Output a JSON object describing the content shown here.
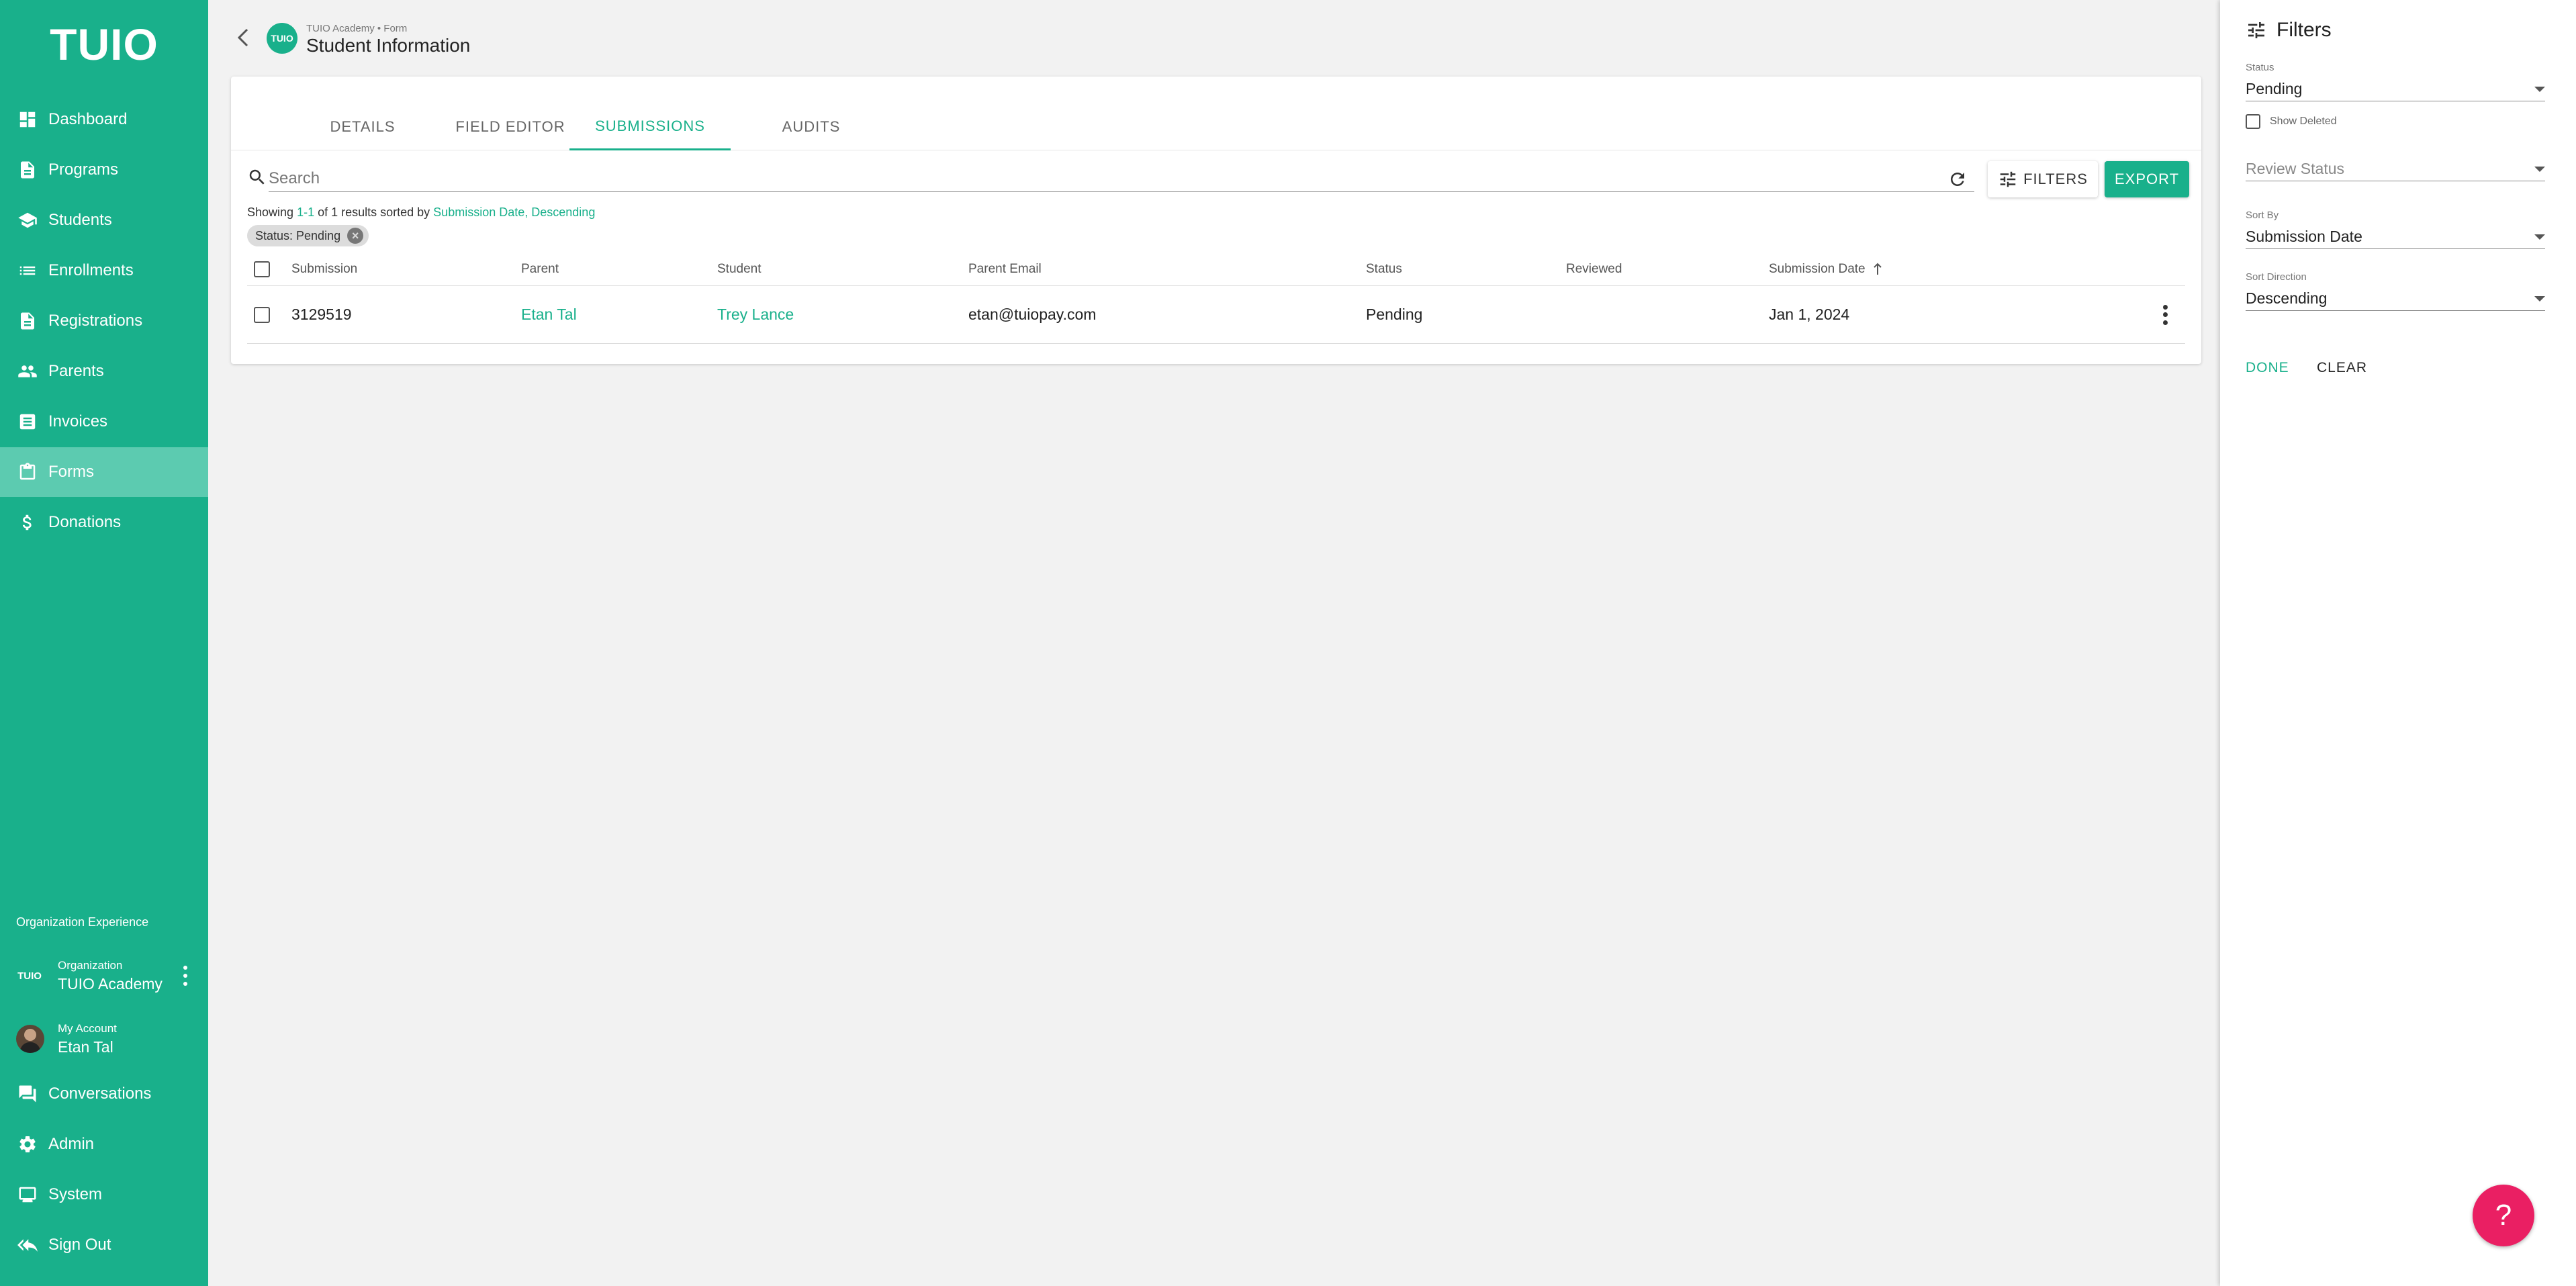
{
  "sidebar": {
    "logo": "TUIO",
    "items": [
      {
        "label": "Dashboard",
        "icon": "dashboard-icon"
      },
      {
        "label": "Programs",
        "icon": "document-icon"
      },
      {
        "label": "Students",
        "icon": "school-icon"
      },
      {
        "label": "Enrollments",
        "icon": "list-icon"
      },
      {
        "label": "Registrations",
        "icon": "document-icon"
      },
      {
        "label": "Parents",
        "icon": "people-icon"
      },
      {
        "label": "Invoices",
        "icon": "receipt-icon"
      },
      {
        "label": "Forms",
        "icon": "clipboard-icon"
      },
      {
        "label": "Donations",
        "icon": "dollar-icon"
      }
    ],
    "active_item": "Forms",
    "org_experience": "Organization Experience",
    "org": {
      "badge": "TUIO",
      "caption": "Organization",
      "name": "TUIO Academy"
    },
    "account": {
      "caption": "My Account",
      "name": "Etan Tal"
    },
    "bottom_items": [
      {
        "label": "Conversations",
        "icon": "chat-icon"
      },
      {
        "label": "Admin",
        "icon": "gear-icon"
      },
      {
        "label": "System",
        "icon": "monitor-icon"
      },
      {
        "label": "Sign Out",
        "icon": "sign-out-icon"
      }
    ]
  },
  "header": {
    "badge": "TUIO",
    "breadcrumb": "TUIO Academy • Form",
    "title": "Student Information"
  },
  "tabs": [
    {
      "label": "DETAILS"
    },
    {
      "label": "FIELD EDITOR"
    },
    {
      "label": "SUBMISSIONS"
    },
    {
      "label": "AUDITS"
    }
  ],
  "active_tab": "SUBMISSIONS",
  "toolbar": {
    "search_placeholder": "Search",
    "filters_label": "FILTERS",
    "export_label": "EXPORT"
  },
  "results": {
    "prefix": "Showing ",
    "range": "1-1",
    "middle": " of 1 results sorted by ",
    "sort_field": "Submission Date",
    "comma": ", ",
    "sort_dir": "Descending"
  },
  "chip": {
    "label": "Status: Pending"
  },
  "table": {
    "columns": [
      "Submission",
      "Parent",
      "Student",
      "Parent Email",
      "Status",
      "Reviewed",
      "Submission Date"
    ],
    "rows": [
      {
        "submission": "3129519",
        "parent": "Etan Tal",
        "student": "Trey Lance",
        "email": "etan@tuiopay.com",
        "status": "Pending",
        "reviewed": "",
        "date": "Jan 1, 2024"
      }
    ]
  },
  "filters_panel": {
    "title": "Filters",
    "status_label": "Status",
    "status_value": "Pending",
    "show_deleted": "Show Deleted",
    "review_status_placeholder": "Review Status",
    "sort_by_label": "Sort By",
    "sort_by_value": "Submission Date",
    "sort_dir_label": "Sort Direction",
    "sort_dir_value": "Descending",
    "done": "DONE",
    "clear": "CLEAR"
  },
  "help": {
    "label": "?"
  },
  "colors": {
    "brand": "#19b08b",
    "active_nav": "#5ccbb0",
    "help": "#ea1f63"
  }
}
